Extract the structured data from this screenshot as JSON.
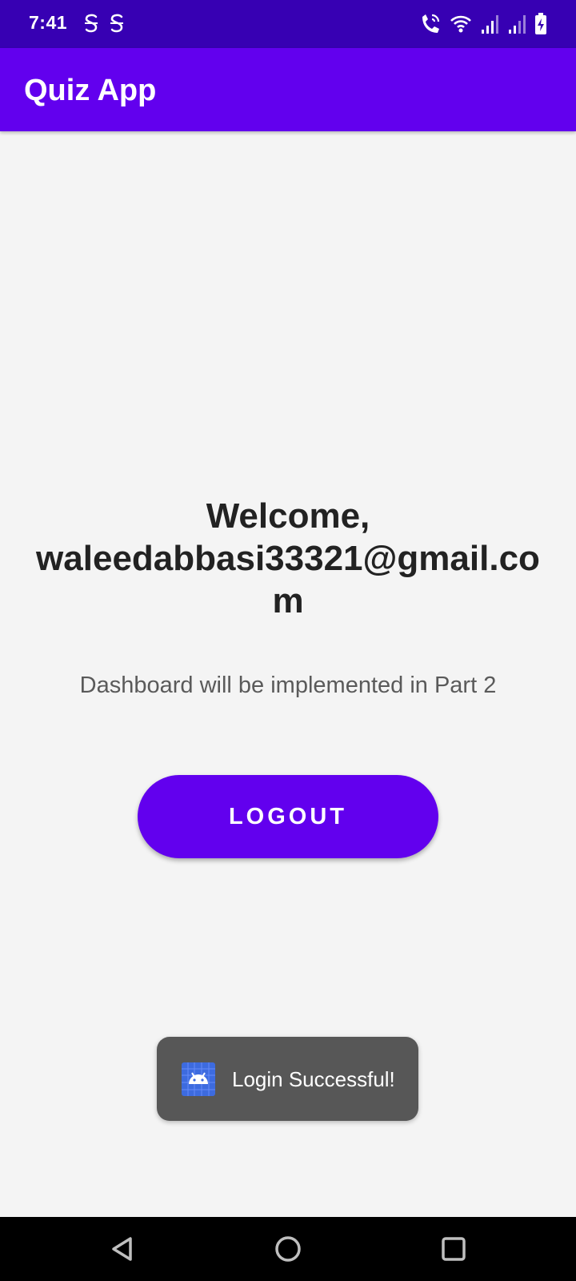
{
  "status_bar": {
    "time": "7:41",
    "notification_icons": [
      "s-notification-icon",
      "s-notification-icon"
    ],
    "right_icons": [
      "wifi-calling-icon",
      "wifi-icon",
      "signal-icon",
      "signal-icon",
      "battery-charging-icon"
    ]
  },
  "app_bar": {
    "title": "Quiz App"
  },
  "main": {
    "welcome_prefix": "Welcome,",
    "welcome_email": "waleedabbasi33321@gmail.com",
    "subtitle": "Dashboard will be implemented in Part 2",
    "logout_label": "LOGOUT"
  },
  "toast": {
    "icon": "android-app-icon",
    "message": "Login Successful!"
  },
  "nav_bar": {
    "buttons": [
      "back-icon",
      "home-icon",
      "recents-icon"
    ]
  },
  "colors": {
    "status_bar": "#3700b3",
    "primary": "#6200ee",
    "background": "#f4f4f4",
    "toast": "#575757"
  }
}
